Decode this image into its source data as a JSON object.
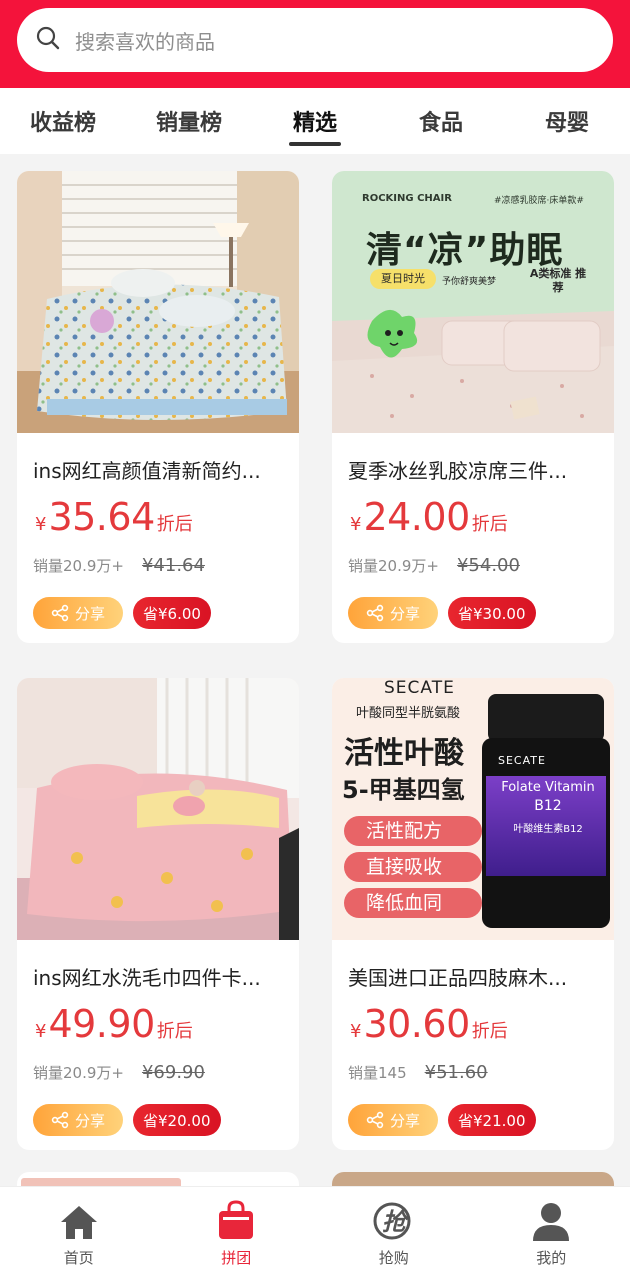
{
  "search": {
    "placeholder": "搜索喜欢的商品",
    "icon": "search-icon"
  },
  "tabs": [
    {
      "label": "收益榜",
      "active": false
    },
    {
      "label": "销量榜",
      "active": false
    },
    {
      "label": "精选",
      "active": true
    },
    {
      "label": "食品",
      "active": false
    },
    {
      "label": "母婴",
      "active": false
    }
  ],
  "products": [
    {
      "title": "ins网红高颜值清新简约...",
      "yen": "¥",
      "price": "35.64",
      "price_suffix": "折后",
      "sales": "销量20.9万+",
      "original_price": "¥41.64",
      "share_label": "分享",
      "save_label": "省¥6.00"
    },
    {
      "title": "夏季冰丝乳胶凉席三件...",
      "yen": "¥",
      "price": "24.00",
      "price_suffix": "折后",
      "sales": "销量20.9万+",
      "original_price": "¥54.00",
      "share_label": "分享",
      "save_label": "省¥30.00",
      "image_text": {
        "brand": "ROCKING CHAIR",
        "tag": "#凉感乳胶席·床单款#",
        "headline": "清“凉”助眠",
        "badge1": "夏日时光",
        "badge1_sub": "予你舒爽美梦",
        "badge2": "A类标准 推荐"
      }
    },
    {
      "title": "ins网红水洗毛巾四件卡...",
      "yen": "¥",
      "price": "49.90",
      "price_suffix": "折后",
      "sales": "销量20.9万+",
      "original_price": "¥69.90",
      "share_label": "分享",
      "save_label": "省¥20.00"
    },
    {
      "title": "美国进口正品四肢麻木...",
      "yen": "¥",
      "price": "30.60",
      "price_suffix": "折后",
      "sales": "销量145",
      "original_price": "¥51.60",
      "share_label": "分享",
      "save_label": "省¥21.00",
      "image_text": {
        "brand": "SECATE",
        "subtitle": "叶酸同型半胱氨酸",
        "headline1": "活性叶酸",
        "headline2": "5-甲基四氢",
        "feature1": "活性配方",
        "feature2": "直接吸收",
        "feature3": "降低血同",
        "bottle_brand": "SECATE",
        "bottle_line1": "Folate Vitamin",
        "bottle_line2": "B12",
        "bottle_cn": "叶酸维生素B12"
      }
    }
  ],
  "bottom_nav": [
    {
      "label": "首页",
      "icon": "home-icon",
      "active": false
    },
    {
      "label": "拼团",
      "icon": "shopping-bag-icon",
      "active": true
    },
    {
      "label": "抢购",
      "icon": "flash-sale-icon",
      "icon_text": "抢",
      "active": false
    },
    {
      "label": "我的",
      "icon": "user-icon",
      "active": false
    }
  ],
  "colors": {
    "brand_red": "#f4133b",
    "price_red": "#e4393c",
    "share_orange": "#ffa43a"
  }
}
